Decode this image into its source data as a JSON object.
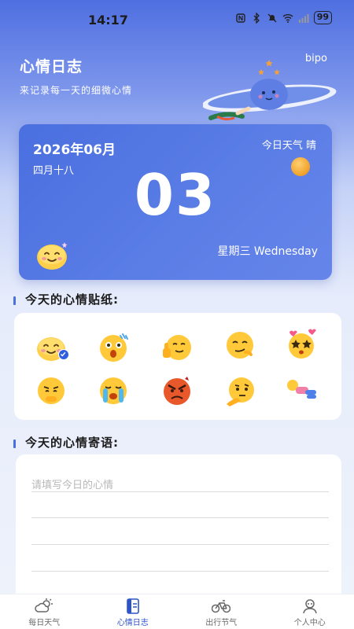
{
  "status_bar": {
    "time": "14:17",
    "battery": "99"
  },
  "header": {
    "title": "心情日志",
    "subtitle": "来记录每一天的细微心情",
    "brand": "bipo"
  },
  "date_card": {
    "year_month": "2026年06月",
    "lunar_date": "四月十八",
    "weather": "今日天气 晴",
    "day": "03",
    "weekday": "星期三 Wednesday",
    "weather_icon": "sun-icon"
  },
  "stickers_section": {
    "title": "今天的心情贴纸:",
    "selected_index": 0,
    "stickers": [
      {
        "icon": "happy-blush-face-icon"
      },
      {
        "icon": "surprised-sweat-face-icon"
      },
      {
        "icon": "thumbs-up-face-icon"
      },
      {
        "icon": "smirk-face-icon"
      },
      {
        "icon": "star-eyes-face-icon"
      },
      {
        "icon": "pleading-face-icon"
      },
      {
        "icon": "crying-face-icon"
      },
      {
        "icon": "angry-face-icon"
      },
      {
        "icon": "thinking-face-icon"
      },
      {
        "icon": "lying-down-figure-icon"
      }
    ]
  },
  "note_section": {
    "title": "今天的心情寄语:",
    "placeholder": "请填写今日的心情",
    "value": ""
  },
  "nav": {
    "active_index": 1,
    "items": [
      {
        "label": "每日天气",
        "icon": "weather-cloud-sun-icon"
      },
      {
        "label": "心情日志",
        "icon": "journal-icon"
      },
      {
        "label": "出行节气",
        "icon": "bicycle-icon"
      },
      {
        "label": "个人中心",
        "icon": "person-icon"
      }
    ]
  },
  "colors": {
    "accent": "#4a6fdf",
    "active_nav": "#2f54c8",
    "card_bg": "#5577e3"
  }
}
